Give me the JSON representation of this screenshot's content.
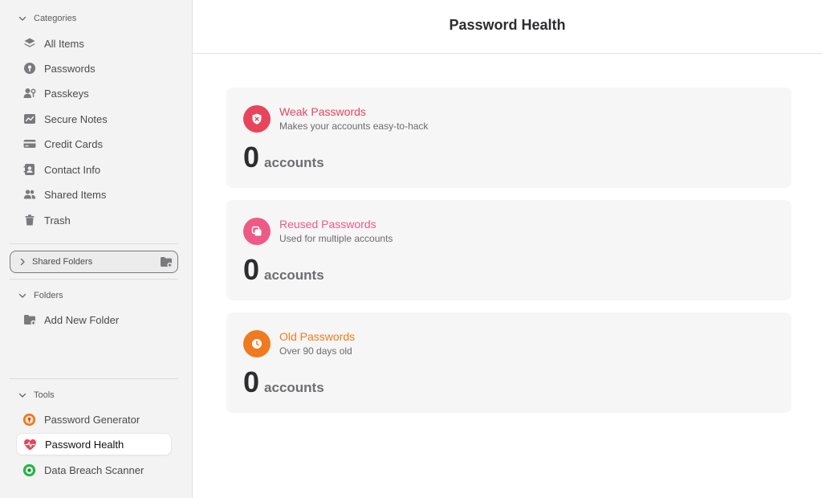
{
  "sidebar": {
    "categories": {
      "header": "Categories",
      "items": [
        {
          "label": "All Items",
          "icon": "stack-icon"
        },
        {
          "label": "Passwords",
          "icon": "key-icon"
        },
        {
          "label": "Passkeys",
          "icon": "passkey-icon"
        },
        {
          "label": "Secure Notes",
          "icon": "note-icon"
        },
        {
          "label": "Credit Cards",
          "icon": "credit-card-icon"
        },
        {
          "label": "Contact Info",
          "icon": "contact-card-icon"
        },
        {
          "label": "Shared Items",
          "icon": "people-icon"
        },
        {
          "label": "Trash",
          "icon": "trash-icon"
        }
      ]
    },
    "shared_folders": {
      "label": "Shared Folders"
    },
    "folders": {
      "header": "Folders",
      "items": [
        {
          "label": "Add New Folder",
          "icon": "folder-add-icon"
        }
      ]
    },
    "tools": {
      "header": "Tools",
      "items": [
        {
          "label": "Password Generator",
          "icon": "password-generator-icon"
        },
        {
          "label": "Password Health",
          "icon": "heart-pulse-icon",
          "active": true
        },
        {
          "label": "Data Breach Scanner",
          "icon": "breach-scanner-icon"
        }
      ]
    }
  },
  "main": {
    "title": "Password Health",
    "cards": [
      {
        "title": "Weak Passwords",
        "subtitle": "Makes your accounts easy-to-hack",
        "count": "0",
        "unit": "accounts",
        "color": "#e8445a",
        "icon": "shield-x-icon"
      },
      {
        "title": "Reused Passwords",
        "subtitle": "Used for multiple accounts",
        "count": "0",
        "unit": "accounts",
        "color": "#ee5a86",
        "icon": "copy-icon"
      },
      {
        "title": "Old Passwords",
        "subtitle": "Over 90 days old",
        "count": "0",
        "unit": "accounts",
        "color": "#f07a1f",
        "icon": "clock-icon"
      }
    ]
  }
}
